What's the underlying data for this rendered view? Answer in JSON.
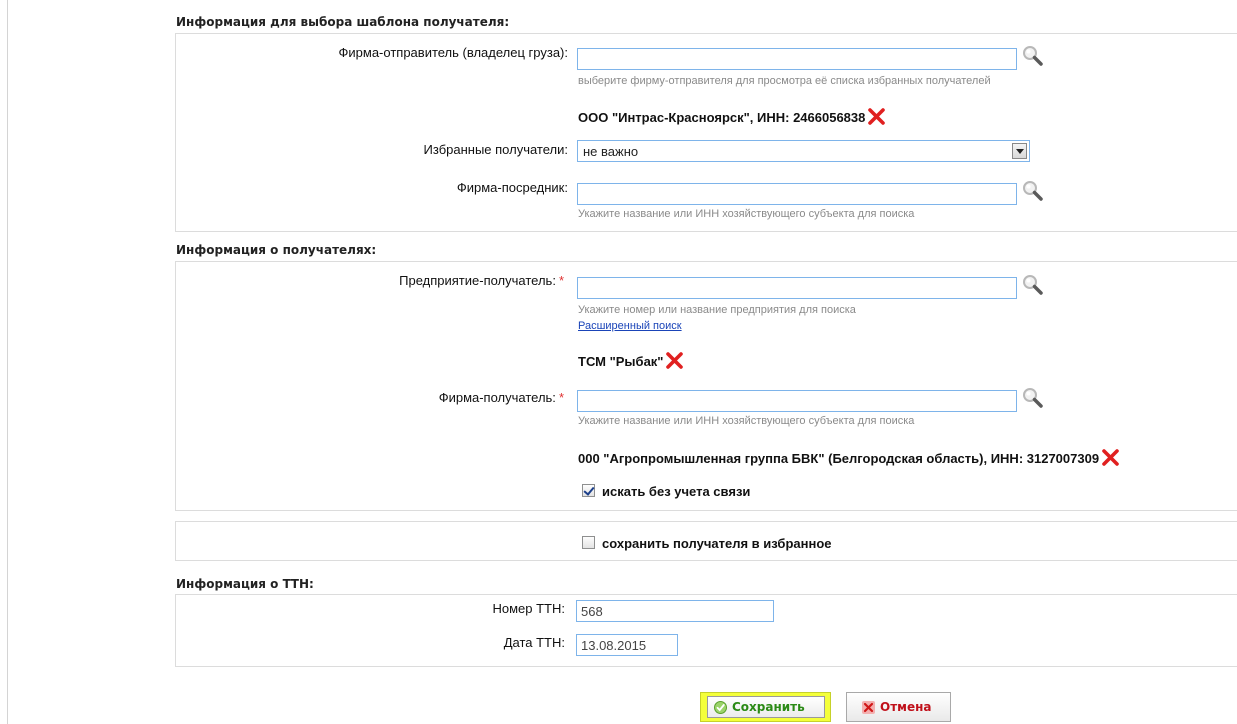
{
  "template_section": {
    "title": "Информация для выбора шаблона получателя:",
    "sender_label": "Фирма-отправитель (владелец груза):",
    "sender_value": "",
    "sender_hint": "выберите фирму-отправителя для просмотра её списка избранных получателей",
    "sender_selected": "ООО \"Интрас-Красноярск\", ИНН: 2466056838",
    "favorites_label": "Избранные получатели:",
    "favorites_selected": "не важно",
    "intermediary_label": "Фирма-посредник:",
    "intermediary_value": "",
    "intermediary_hint": "Укажите название или ИНН хозяйствующего субъекта для поиска"
  },
  "recipients_section": {
    "title": "Информация о получателях:",
    "enterprise_label": "Предприятие-получатель:",
    "required_mark": "*",
    "enterprise_value": "",
    "enterprise_hint": "Укажите номер или название предприятия для поиска",
    "advanced_search": "Расширенный поиск",
    "enterprise_selected": "ТСМ \"Рыбак\"",
    "firm_label": "Фирма-получатель:",
    "firm_value": "",
    "firm_hint": "Укажите название или ИНН хозяйствующего субъекта для поиска",
    "firm_selected": "000 \"Агропромышленная группа БВК\" (Белгородская область), ИНН: 3127007309",
    "ignore_link_label": "искать без учета связи",
    "ignore_link_checked": true
  },
  "save_favorite": {
    "label": "сохранить получателя в избранное",
    "checked": false
  },
  "ttn_section": {
    "title": "Информация о ТТН:",
    "number_label": "Номер ТТН:",
    "number_value": "568",
    "date_label": "Дата ТТН:",
    "date_value": "13.08.2015"
  },
  "actions": {
    "save_label": "Сохранить",
    "cancel_label": "Отмена"
  },
  "colors": {
    "input_border": "#7eb4ea",
    "remove_x": "#e02020",
    "save_highlight": "#f4ff3a",
    "save_text": "#2b8a16",
    "cancel_text": "#c0101a",
    "link": "#1a44b8"
  }
}
